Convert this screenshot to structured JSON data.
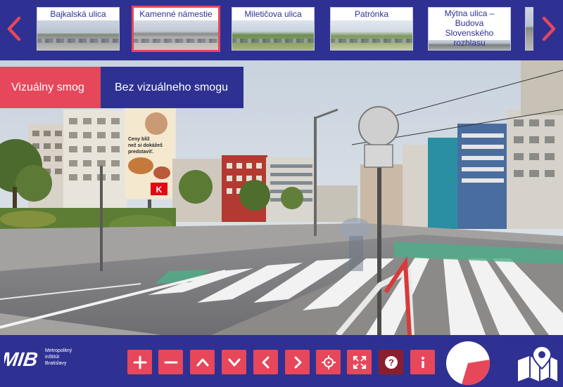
{
  "thumbnails": [
    {
      "label": "Bajkalská ulica",
      "active": false
    },
    {
      "label": "Kamenné námestie",
      "active": true
    },
    {
      "label": "Miletičova ulica",
      "active": false
    },
    {
      "label": "Patrónka",
      "active": false
    },
    {
      "label": "Mýtna ulica – Budova Slovenského rozhlasu",
      "active": false
    }
  ],
  "mode_toggle": {
    "visual_smog_label": "Vizuálny smog",
    "no_visual_smog_label": "Bez vizuálneho smogu"
  },
  "logo": {
    "mark": "MIB",
    "line1": "Metropolitný",
    "line2": "inštitút",
    "line3": "Bratislavy"
  },
  "toolbar": [
    {
      "name": "zoom-in-button",
      "icon": "plus-icon"
    },
    {
      "name": "zoom-out-button",
      "icon": "minus-icon"
    },
    {
      "name": "pan-up-button",
      "icon": "chevron-up-icon"
    },
    {
      "name": "pan-down-button",
      "icon": "chevron-down-icon"
    },
    {
      "name": "pan-left-button",
      "icon": "chevron-left-icon"
    },
    {
      "name": "pan-right-button",
      "icon": "chevron-right-icon"
    },
    {
      "name": "gyroscope-button",
      "icon": "crosshair-icon"
    },
    {
      "name": "fullscreen-button",
      "icon": "fullscreen-icon"
    },
    {
      "name": "help-button",
      "icon": "question-icon"
    },
    {
      "name": "info-button",
      "icon": "info-icon"
    }
  ],
  "colors": {
    "brand_blue": "#2e3192",
    "accent_red": "#e6475a",
    "accent_dark_red": "#8b1e2e"
  },
  "billboard": {
    "line1": "Ceny blíž",
    "line2": "než si dokážeš",
    "line3": "predstaviť.",
    "brand": "K"
  }
}
